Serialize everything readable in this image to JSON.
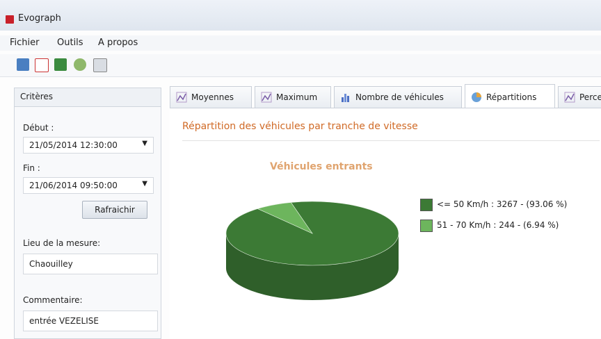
{
  "window": {
    "title": "Evograph"
  },
  "menu": [
    "Fichier",
    "Outils",
    "A propos"
  ],
  "toolbar": [
    "open-folder-icon",
    "pdf-icon",
    "save-icon",
    "money-icon",
    "print-icon"
  ],
  "criteria": {
    "title": "Critères",
    "start_label": "Début :",
    "start_value": "21/05/2014 12:30:00",
    "end_label": "Fin :",
    "end_value": "21/06/2014 09:50:00",
    "refresh_label": "Rafraichir",
    "location_label": "Lieu de la mesure:",
    "location_value": "Chaouilley",
    "comment_label": "Commentaire:",
    "comment_value": "entrée VEZELISE"
  },
  "tabs": [
    {
      "label": "Moyennes",
      "icon": "line-chart-icon"
    },
    {
      "label": "Maximum",
      "icon": "line-chart-icon"
    },
    {
      "label": "Nombre de véhicules",
      "icon": "bar-chart-icon"
    },
    {
      "label": "Répartitions",
      "icon": "pie-chart-icon",
      "active": true
    },
    {
      "label": "Perce",
      "icon": "line-chart-icon"
    }
  ],
  "content": {
    "heading": "Répartition des véhicules par tranche de vitesse"
  },
  "chart_data": {
    "type": "pie",
    "title": "Véhicules entrants",
    "labels": [
      "<= 50 Km/h : 3267 - (93.06 %)",
      "51 - 70 Km/h : 244 - (6.94 %)"
    ],
    "series": [
      {
        "name": "<= 50 Km/h",
        "value": 3267,
        "percent": 93.06
      },
      {
        "name": "51 - 70 Km/h",
        "value": 244,
        "percent": 6.94
      }
    ],
    "colors": [
      "#3c7a35",
      "#6db55d"
    ],
    "legend_position": "right"
  }
}
